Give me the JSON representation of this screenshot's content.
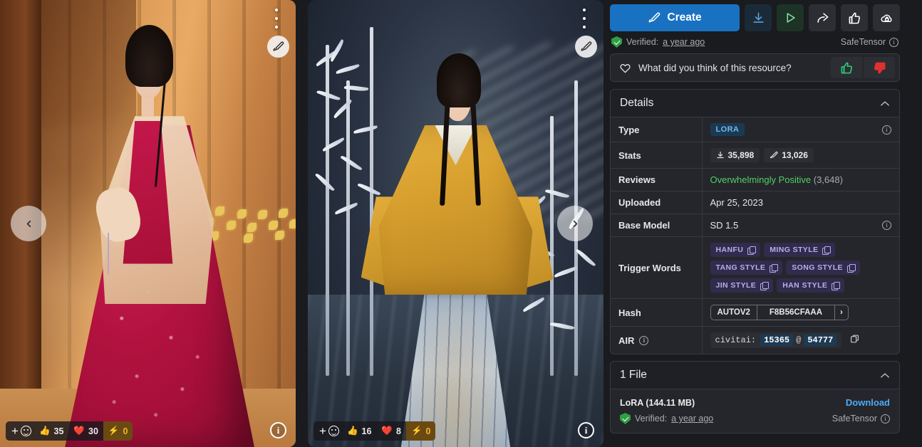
{
  "gallery": {
    "images": [
      {
        "alt": "Woman in red hanfu standing before a wooden wall",
        "menu_icon": "dots-vertical-icon",
        "brush_icon": "paintbrush-icon",
        "prev_icon": "chevron-left-icon",
        "info_icon": "info-icon",
        "reactions": {
          "add_label": "+",
          "emoji_icon": "smiley-icon",
          "thumbs_up": "35",
          "heart": "30",
          "energy": "0"
        }
      },
      {
        "alt": "Woman in yellow hanfu with silver bamboo background",
        "menu_icon": "dots-vertical-icon",
        "brush_icon": "paintbrush-icon",
        "next_icon": "chevron-right-icon",
        "info_icon": "info-icon",
        "reactions": {
          "add_label": "+",
          "emoji_icon": "smiley-icon",
          "thumbs_up": "16",
          "heart": "8",
          "energy": "0"
        }
      }
    ]
  },
  "panel": {
    "actions": {
      "create_label": "Create",
      "create_icon": "paintbrush-icon",
      "download_icon": "download-icon",
      "run_icon": "play-icon",
      "share_icon": "share-icon",
      "like_icon": "thumbs-up-icon",
      "vault_icon": "cloud-lock-icon"
    },
    "verified": {
      "prefix": "Verified:",
      "time": "a year ago",
      "shield_icon": "shield-check-icon",
      "safetensor_label": "SafeTensor",
      "info_icon": "info-icon"
    },
    "feedback": {
      "heart_icon": "heart-outline-icon",
      "question": "What did you think of this resource?",
      "up_icon": "thumbs-up-icon",
      "down_icon": "thumbs-down-icon"
    },
    "details": {
      "title": "Details",
      "collapse_icon": "chevron-up-icon",
      "rows": {
        "type": {
          "label": "Type",
          "value": "LORA",
          "info_icon": "info-icon"
        },
        "stats": {
          "label": "Stats",
          "downloads": "35,898",
          "downloads_icon": "download-icon",
          "generations": "13,026",
          "generations_icon": "paintbrush-icon"
        },
        "reviews": {
          "label": "Reviews",
          "sentiment": "Overwhelmingly Positive",
          "count": "(3,648)"
        },
        "uploaded": {
          "label": "Uploaded",
          "value": "Apr 25, 2023"
        },
        "base_model": {
          "label": "Base Model",
          "value": "SD 1.5",
          "info_icon": "info-icon"
        },
        "trigger_words": {
          "label": "Trigger Words",
          "chips": [
            "HANFU",
            "MING STYLE",
            "TANG STYLE",
            "SONG STYLE",
            "JIN STYLE",
            "HAN STYLE"
          ],
          "copy_icon": "copy-icon",
          "highlight_color": "#f03e3e"
        },
        "hash": {
          "label": "Hash",
          "algo": "AUTOV2",
          "value": "F8B56CFAAA",
          "expand_icon": "chevron-right-icon"
        },
        "air": {
          "label": "AIR",
          "info_icon": "info-icon",
          "prefix": "civitai:",
          "model_id": "15365",
          "separator": "@",
          "version_id": "54777",
          "copy_icon": "copy-icon"
        }
      }
    },
    "files": {
      "title": "1 File",
      "collapse_icon": "chevron-up-icon",
      "name": "LoRA (144.11 MB)",
      "download_label": "Download",
      "shield_icon": "shield-check-icon",
      "verified_prefix": "Verified:",
      "verified_time": "a year ago",
      "format": "SafeTensor",
      "info_icon": "info-icon"
    }
  },
  "colors": {
    "accent_blue": "#1971c2",
    "link_blue": "#4dabf7",
    "green": "#51cf66",
    "chip_bg": "#312b4d",
    "chip_text": "#b9aee8",
    "highlight_red": "#f03e3e",
    "panel_bg": "#1a1b1e",
    "card_bg": "#25262b"
  }
}
